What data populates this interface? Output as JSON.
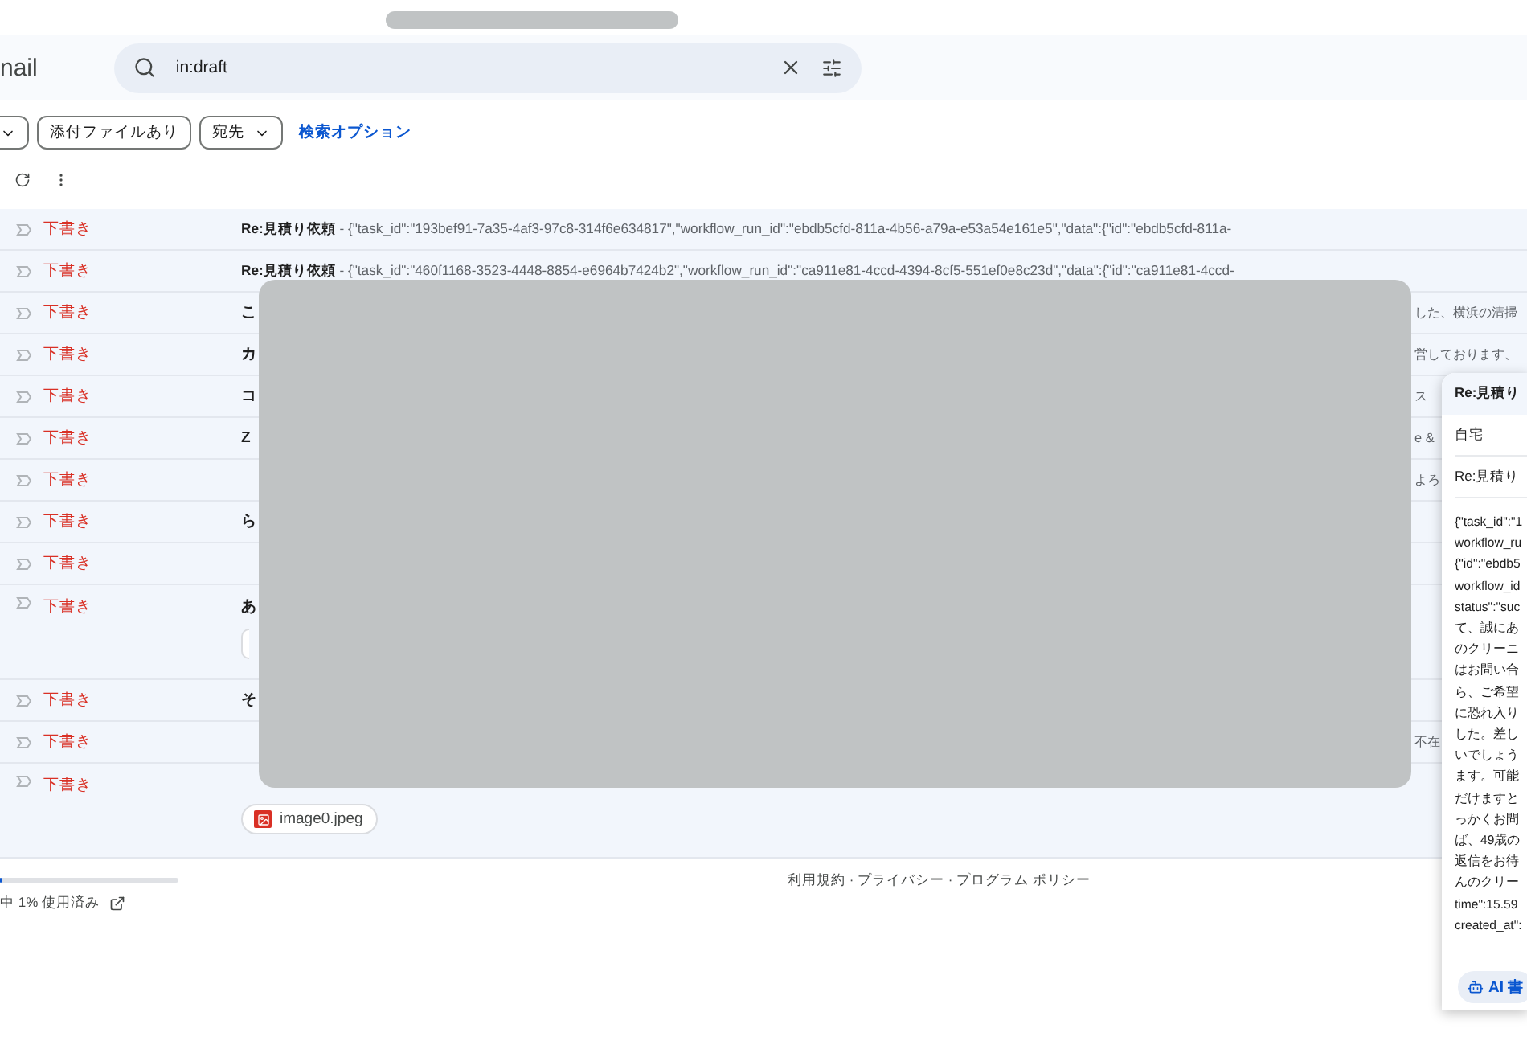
{
  "header": {
    "logo_text": "nail",
    "search": {
      "value": "in:draft"
    }
  },
  "filters": [
    {
      "kind": "caret"
    },
    {
      "kind": "plain",
      "label": "添付ファイルあり"
    },
    {
      "kind": "dropdown",
      "label": "宛先"
    }
  ],
  "search_options_link": "検索オプション",
  "rows": [
    {
      "status": "下書き",
      "subject": "Re:見積り依頼",
      "snippet": " - {\"task_id\":\"193bef91-7a35-4af3-97c8-314f6e634817\",\"workflow_run_id\":\"ebdb5cfd-811a-4b56-a79a-e53a54e161e5\",\"data\":{\"id\":\"ebdb5cfd-811a-"
    },
    {
      "status": "下書き",
      "subject": "Re:見積り依頼",
      "snippet": " - {\"task_id\":\"460f1168-3523-4448-8854-e6964b7424b2\",\"workflow_run_id\":\"ca911e81-4ccd-4394-8cf5-551ef0e8c23d\",\"data\":{\"id\":\"ca911e81-4ccd-"
    },
    {
      "status": "下書き",
      "lead": "こ",
      "tail": "した、横浜の清掃"
    },
    {
      "status": "下書き",
      "lead": "カ",
      "tail": "営しております、"
    },
    {
      "status": "下書き",
      "lead": "コ",
      "tail": "ス"
    },
    {
      "status": "下書き",
      "lead": "Z",
      "tail": "e &"
    },
    {
      "status": "下書き",
      "tail": "よろ"
    },
    {
      "status": "下書き",
      "lead": "ら"
    },
    {
      "status": "下書き"
    },
    {
      "status": "下書き",
      "lead": "あ",
      "attachment": {
        "kind": "chip"
      }
    },
    {
      "status": "下書き",
      "lead": "そ"
    },
    {
      "status": "下書き",
      "tail": "不在"
    },
    {
      "status": "下書き",
      "attachment": {
        "kind": "image",
        "name": "image0.jpeg"
      }
    }
  ],
  "footer": {
    "storage": "中 1% 使用済み",
    "storage_meter": {
      "level": 0.01
    },
    "links": "利用規約 · プライバシー · プログラム ポリシー"
  },
  "compose": {
    "title": "Re:見積り",
    "from": "自宅",
    "subject": "Re:見積り",
    "body_lines": [
      "{\"task_id\":\"1",
      "workflow_ru",
      "{\"id\":\"ebdb5",
      "workflow_id",
      "status\":\"suc",
      "て、誠にあ",
      "のクリーニ",
      "はお問い合",
      "ら、ご希望",
      "に恐れ入り",
      "した。差し",
      "いでしょう",
      "ます。可能",
      "だけますと",
      "っかくお問",
      "ば、49歳の",
      "返信をお待",
      "んのクリー",
      "time\":15.59",
      "created_at\":"
    ],
    "ai_button": "AI 書"
  }
}
